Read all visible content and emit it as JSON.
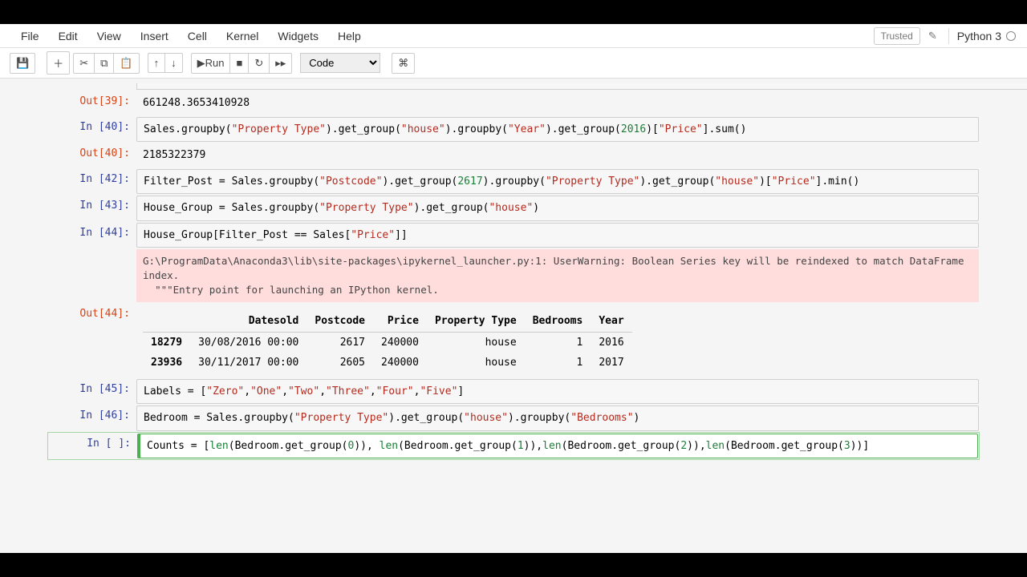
{
  "menu": {
    "items": [
      "File",
      "Edit",
      "View",
      "Insert",
      "Cell",
      "Kernel",
      "Widgets",
      "Help"
    ],
    "trusted": "Trusted",
    "kernel": "Python 3"
  },
  "toolbar": {
    "celltype": "Code",
    "run": "Run"
  },
  "cells": {
    "out39": {
      "label": "Out[39]:",
      "text": "661248.3653410928"
    },
    "in40": {
      "label": "In [40]:"
    },
    "out40": {
      "label": "Out[40]:",
      "text": "2185322379"
    },
    "in42": {
      "label": "In [42]:"
    },
    "in43": {
      "label": "In [43]:"
    },
    "in44": {
      "label": "In [44]:"
    },
    "warn": "G:\\ProgramData\\Anaconda3\\lib\\site-packages\\ipykernel_launcher.py:1: UserWarning: Boolean Series key will be reindexed to match DataFrame index.\n  \"\"\"Entry point for launching an IPython kernel.",
    "out44": {
      "label": "Out[44]:"
    },
    "in45": {
      "label": "In [45]:"
    },
    "in46": {
      "label": "In [46]:"
    },
    "inNew": {
      "label": "In [ ]:"
    }
  },
  "chart_data": {
    "type": "table",
    "columns": [
      "",
      "Datesold",
      "Postcode",
      "Price",
      "Property Type",
      "Bedrooms",
      "Year"
    ],
    "rows": [
      [
        "18279",
        "30/08/2016 00:00",
        "2617",
        "240000",
        "house",
        "1",
        "2016"
      ],
      [
        "23936",
        "30/11/2017 00:00",
        "2605",
        "240000",
        "house",
        "1",
        "2017"
      ]
    ]
  },
  "code": {
    "c40": {
      "p0": "Sales.groupby(",
      "s0": "\"Property Type\"",
      "p1": ").get_group(",
      "s1": "\"house\"",
      "p2": ").groupby(",
      "s2": "\"Year\"",
      "p3": ").get_group(",
      "n0": "2016",
      "p4": ")[",
      "s3": "\"Price\"",
      "p5": "].sum()"
    },
    "c42": {
      "p0": "Filter_Post = Sales.groupby(",
      "s0": "\"Postcode\"",
      "p1": ").get_group(",
      "n0": "2617",
      "p2": ").groupby(",
      "s1": "\"Property Type\"",
      "p3": ").get_group(",
      "s2": "\"house\"",
      "p4": ")[",
      "s3": "\"Price\"",
      "p5": "].min()"
    },
    "c43": {
      "p0": "House_Group = Sales.groupby(",
      "s0": "\"Property Type\"",
      "p1": ").get_group(",
      "s1": "\"house\"",
      "p2": ")"
    },
    "c44": {
      "p0": "House_Group[Filter_Post == Sales[",
      "s0": "\"Price\"",
      "p1": "]]"
    },
    "c45": {
      "p0": "Labels = [",
      "s0": "\"Zero\"",
      "c0": ",",
      "s1": "\"One\"",
      "c1": ",",
      "s2": "\"Two\"",
      "c2": ",",
      "s3": "\"Three\"",
      "c3": ",",
      "s4": "\"Four\"",
      "c4": ",",
      "s5": "\"Five\"",
      "p1": "]"
    },
    "c46": {
      "p0": "Bedroom = Sales.groupby(",
      "s0": "\"Property Type\"",
      "p1": ").get_group(",
      "s1": "\"house\"",
      "p2": ").groupby(",
      "s2": "\"Bedrooms\"",
      "p3": ")"
    },
    "cNew": {
      "p0": "Counts = [",
      "b0": "len",
      "p1": "(Bedroom.get_group(",
      "n0": "0",
      "p2": ")), ",
      "b1": "len",
      "p3": "(Bedroom.get_group(",
      "n1": "1",
      "p4": ")),",
      "b2": "len",
      "p5": "(Bedroom.get_group(",
      "n2": "2",
      "p6": ")),",
      "b3": "len",
      "p7": "(Bedroom.get_group(",
      "n3": "3",
      "p8": "))]"
    }
  }
}
